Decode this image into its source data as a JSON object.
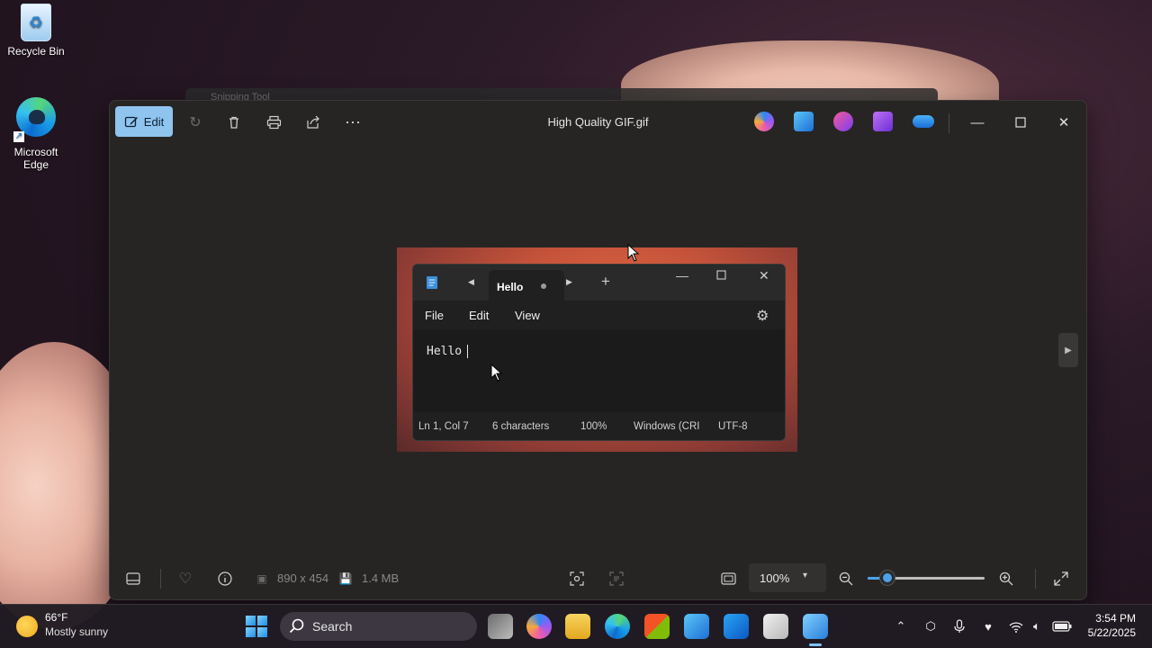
{
  "desktop": {
    "recycle_bin_label": "Recycle Bin",
    "edge_label_line1": "Microsoft",
    "edge_label_line2": "Edge"
  },
  "background_window": {
    "title": "Snipping Tool"
  },
  "photos": {
    "title": "High Quality GIF.gif",
    "toolbar": {
      "edit_label": "Edit",
      "icons": [
        "edit-icon",
        "rotate-icon",
        "delete-icon",
        "print-icon",
        "share-icon",
        "more-icon"
      ]
    },
    "app_icons": [
      "copilot-icon",
      "designer-icon",
      "clipchamp-icon",
      "video-editor-icon",
      "onedrive-icon"
    ],
    "window_controls": [
      "minimize",
      "maximize",
      "close"
    ],
    "bottom": {
      "dimensions": "890 x 454",
      "file_size": "1.4 MB",
      "zoom": "100%",
      "zoom_level_fraction": 0.17
    }
  },
  "notepad": {
    "tab_label": "Hello",
    "menu": [
      "File",
      "Edit",
      "View"
    ],
    "content": "Hello",
    "status": {
      "position": "Ln 1, Col 7",
      "characters": "6 characters",
      "zoom": "100%",
      "line_ending": "Windows (CRI",
      "encoding": "UTF-8"
    }
  },
  "taskbar": {
    "weather_temp": "66°F",
    "weather_desc": "Mostly sunny",
    "search_label": "Search",
    "time": "3:54 PM",
    "date": "5/22/2025",
    "accent": "#7ec3f7"
  }
}
